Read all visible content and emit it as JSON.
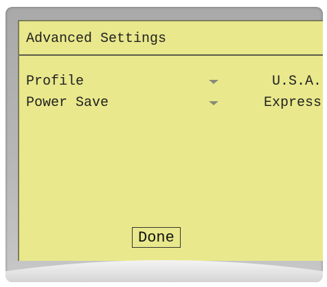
{
  "screen": {
    "title": "Advanced Settings",
    "settings": [
      {
        "label": "Profile",
        "value": "U.S.A."
      },
      {
        "label": "Power Save",
        "value": "Express"
      }
    ],
    "done_label": "Done"
  },
  "colors": {
    "screen_bg": "#e9e88c",
    "frame": "#b8b8b8",
    "text": "#222222"
  },
  "icons": {
    "dropdown": "chevron-down-icon"
  }
}
